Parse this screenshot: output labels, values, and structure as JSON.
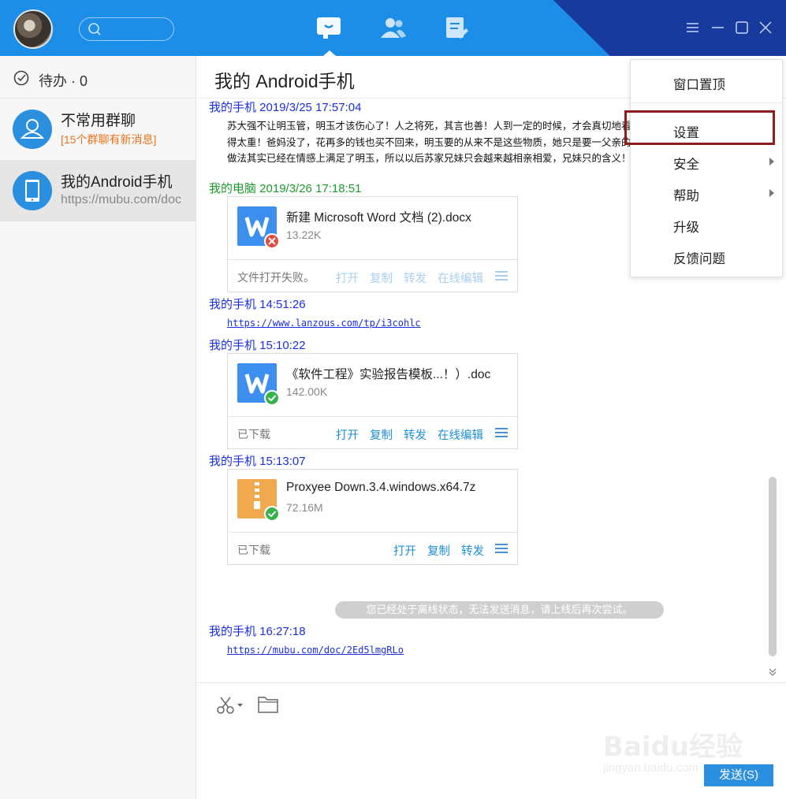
{
  "colors": {
    "topbar": "#1d8ee8",
    "topbar_dark": "#173a9c",
    "link_blue": "#1a2fe0",
    "green_head": "#1d9a2d",
    "action_blue": "#1d8fd6",
    "orange": "#e8721b",
    "highlight": "#8b1e1e"
  },
  "topbar": {
    "nav": [
      "message-icon",
      "contacts-icon",
      "notes-icon"
    ],
    "window_controls": [
      "menu-icon",
      "minimize-icon",
      "maximize-icon",
      "close-icon"
    ]
  },
  "sidebar": {
    "todo_label": "待办 · 0",
    "conversations": [
      {
        "name": "不常用群聊",
        "subtitle": "[15个群聊有新消息]",
        "icon": "group-icon"
      },
      {
        "name": "我的Android手机",
        "subtitle": "https://mubu.com/doc",
        "icon": "phone-icon"
      }
    ]
  },
  "chat": {
    "title": "我的 Android手机",
    "messages": [
      {
        "sender": "我的手机 2019/3/25 17:57:04",
        "text": "苏大强不让明玉管，明玉才该伤心了！人之将死，其言也善！人到一定的时候，才会真切地看得太重！爸妈没了，花再多的钱也买不回来，明玉要的从来不是这些物质，她只是要一父亲的做法其实已经在情感上满足了明玉，所以以后苏家兄妹只会越来越相亲相爱，兄妹只的含义！"
      },
      {
        "sender": "我的电脑 2019/3/26 17:18:51",
        "file": {
          "name": "新建 Microsoft Word 文档 (2).docx",
          "size": "13.22K",
          "status": "文件打开失败。",
          "actions": [
            "打开",
            "复制",
            "转发",
            "在线编辑"
          ]
        }
      },
      {
        "sender": "我的手机  14:51:26",
        "link": "https://www.lanzous.com/tp/i3cohlc"
      },
      {
        "sender": "我的手机  15:10:22",
        "file": {
          "name": "《软件工程》实验报告模板...！）.doc",
          "size": "142.00K",
          "status": "已下载",
          "actions": [
            "打开",
            "复制",
            "转发",
            "在线编辑"
          ]
        }
      },
      {
        "sender": "我的手机  15:13:07",
        "file": {
          "name": "Proxyee Down.3.4.windows.x64.7z",
          "size": "72.16M",
          "status": "已下载",
          "actions": [
            "打开",
            "复制",
            "转发"
          ]
        }
      },
      {
        "sender": "我的手机  16:27:18",
        "link": "https://mubu.com/doc/2Ed5lmgRLo"
      }
    ],
    "offline_notice": "您已经处于离线状态，无法发送消息，请上线后再次尝试。",
    "send_label": "发送(S)"
  },
  "menu": {
    "items": [
      {
        "label": "窗口置顶",
        "submenu": false
      },
      {
        "label": "设置",
        "submenu": false
      },
      {
        "label": "安全",
        "submenu": true
      },
      {
        "label": "帮助",
        "submenu": true
      },
      {
        "label": "升级",
        "submenu": false
      },
      {
        "label": "反馈问题",
        "submenu": false
      }
    ]
  },
  "watermark": {
    "brand": "Baidu经验",
    "url": "jingyan.baidu.com"
  }
}
